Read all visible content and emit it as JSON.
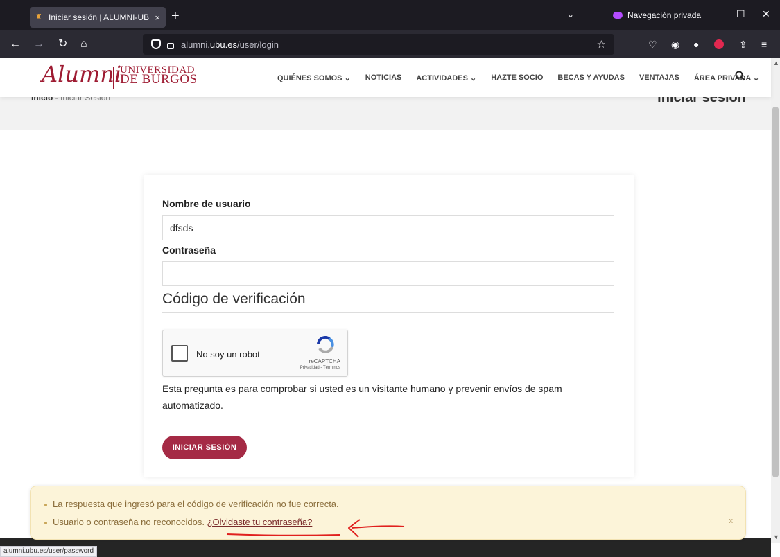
{
  "browser": {
    "tab_title": "Iniciar sesión | ALUMNI-UBU As",
    "tab_close": "×",
    "new_tab": "+",
    "private_label": "Navegación privada",
    "url_domain": "alumni.",
    "url_bold": "ubu.es",
    "url_path": "/user/login",
    "status_url": "alumni.ubu.es/user/password"
  },
  "site": {
    "logo_alumni": "Alumni",
    "logo_line1": "UNIVERSIDAD",
    "logo_line2": "DE BURGOS",
    "menu": [
      "QUIÉNES SOMOS ⌄",
      "NOTICIAS",
      "ACTIVIDADES ⌄",
      "HAZTE SOCIO",
      "BECAS Y AYUDAS",
      "VENTAJAS",
      "ÁREA PRIVADA ⌄"
    ],
    "breadcrumb_home": "Inicio",
    "breadcrumb_sep": " - ",
    "breadcrumb_current": "Iniciar Sesión",
    "page_title": "Iniciar sesión"
  },
  "form": {
    "username_label": "Nombre de usuario",
    "username_value": "dfsds",
    "password_label": "Contraseña",
    "password_value": "",
    "captcha_legend": "Código de verificación",
    "captcha_text": "No soy un robot",
    "captcha_brand": "reCAPTCHA",
    "captcha_links": "Privacidad - Términos",
    "captcha_description": "Esta pregunta es para comprobar si usted es un visitante humano y prevenir envíos de spam automatizado.",
    "submit_label": "INICIAR SESIÓN"
  },
  "messages": {
    "error1": "La respuesta que ingresó para el código de verificación no fue correcta.",
    "error2": "Usuario o contraseña no reconocidos.",
    "forgot_link": "¿Olvidaste tu contraseña?",
    "close": "x"
  },
  "colors": {
    "brand": "#9e1b32",
    "button": "#a52a45",
    "alert_bg": "#fcf4d9",
    "annotation": "#e0201e"
  }
}
